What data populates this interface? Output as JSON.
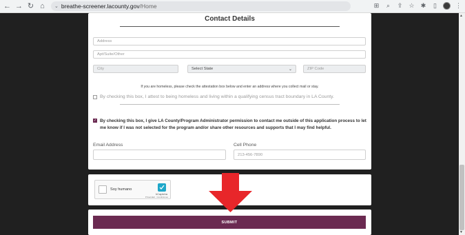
{
  "browser": {
    "url_host": "breathe-screener.lacounty.gov",
    "url_path": "/Home"
  },
  "form": {
    "section_title": "Contact Details",
    "fields": {
      "address_placeholder": "Address",
      "apt_placeholder": "Apt/Suite/Other",
      "city_placeholder": "City",
      "state_selected": "Select State",
      "zip_placeholder": "ZIP Code"
    },
    "homeless_note": "If you are homeless, please check the attestation box below and enter an address where you collect mail or stay.",
    "homeless_checkbox_label": "By checking this box, I attest to being homeless and living within a qualifying census tract boundary in LA County.",
    "permission_checkbox_label": "By checking this box, I give LA County/Program Administrator permission to contact me outside of this application process to let me know if I was not selected for the program and/or share other resources and supports that I may find helpful.",
    "email_label": "Email Address",
    "email_value": "",
    "phone_label": "Cell Phone",
    "phone_placeholder": "213-456-7890"
  },
  "captcha": {
    "label": "Soy humano",
    "brand": "hCaptcha",
    "links": "Privacidad · Condiciones"
  },
  "submit_label": "SUBMIT",
  "colors": {
    "accent": "#6b2a51",
    "arrow": "#e8262a",
    "page_background": "#202020"
  }
}
